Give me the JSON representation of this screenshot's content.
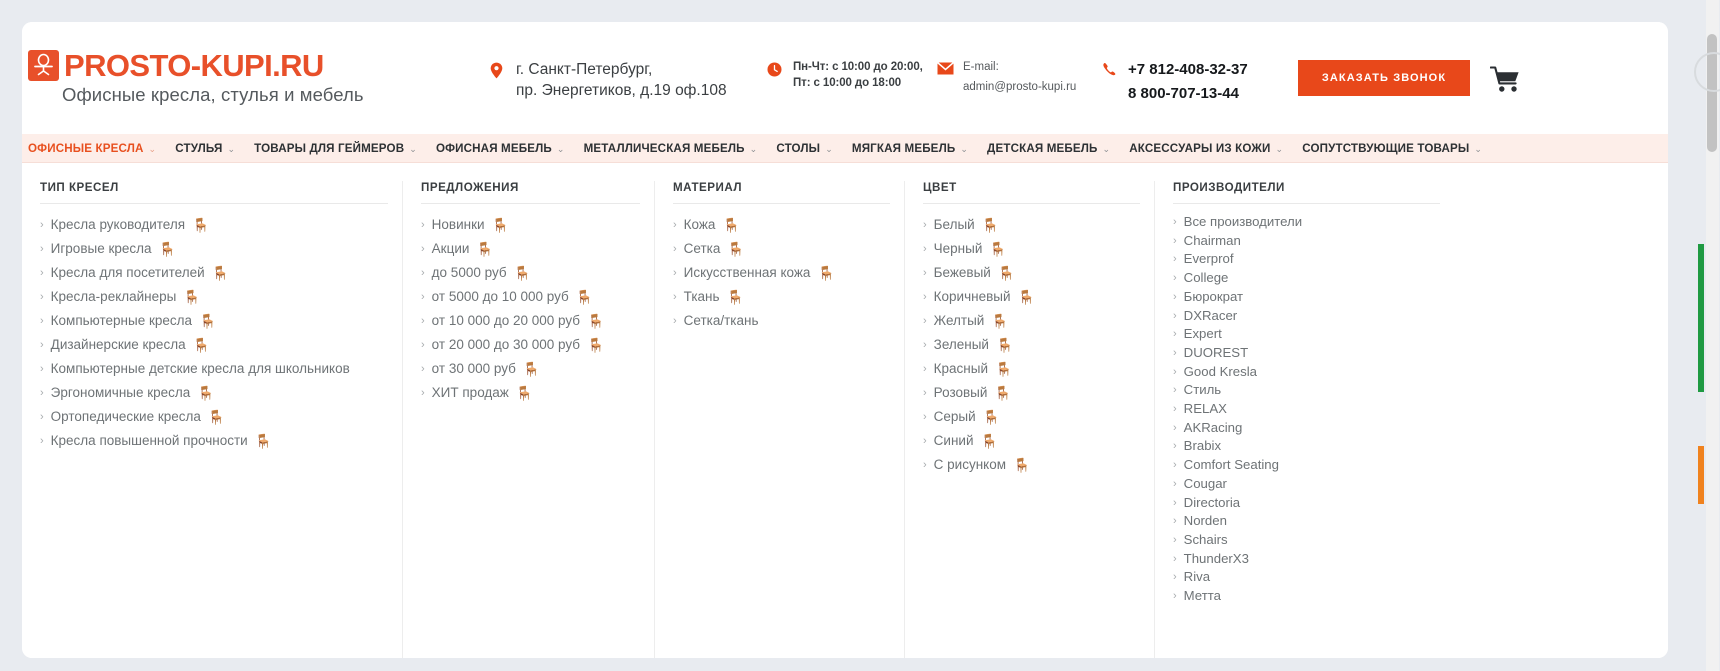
{
  "header": {
    "logo": {
      "mark_icon": "chair-badge-icon",
      "brand": "PROSTO-KUPI.RU",
      "tagline": "Офисные кресла, стулья и мебель"
    },
    "address": {
      "icon": "map-pin-icon",
      "line1": "г. Санкт-Петербург,",
      "line2": "пр. Энергетиков, д.19 оф.108"
    },
    "hours": {
      "icon": "clock-icon",
      "line1": "Пн-Чт: с 10:00 до 20:00,",
      "line2": "Пт: с 10:00 до 18:00"
    },
    "email": {
      "icon": "envelope-icon",
      "label": "E-mail:",
      "value": "admin@prosto-kupi.ru"
    },
    "phone": {
      "icon": "phone-icon",
      "line1": "+7 812-408-32-37",
      "line2": "8 800-707-13-44"
    },
    "cta_label": "ЗАКАЗАТЬ ЗВОНОК",
    "cart_icon": "shopping-cart-icon"
  },
  "colors": {
    "brand_orange": "#e8502a",
    "cta_orange": "#e8481a",
    "nav_bg": "#fdeee9",
    "nav_active": "#e8501f",
    "link_gray": "#6e7376",
    "page_bg": "#e8ebf0"
  },
  "nav": {
    "chevron_icon": "chevron-down-icon",
    "items": [
      {
        "label": "ОФИСНЫЕ КРЕСЛА",
        "active": true
      },
      {
        "label": "СТУЛЬЯ",
        "active": false
      },
      {
        "label": "ТОВАРЫ ДЛЯ ГЕЙМЕРОВ",
        "active": false
      },
      {
        "label": "ОФИСНАЯ МЕБЕЛЬ",
        "active": false
      },
      {
        "label": "МЕТАЛЛИЧЕСКАЯ МЕБЕЛЬ",
        "active": false
      },
      {
        "label": "СТОЛЫ",
        "active": false
      },
      {
        "label": "МЯГКАЯ МЕБЕЛЬ",
        "active": false
      },
      {
        "label": "ДЕТСКАЯ МЕБЕЛЬ",
        "active": false
      },
      {
        "label": "АКСЕССУАРЫ ИЗ КОЖИ",
        "active": false
      },
      {
        "label": "СОПУТСТВУЮЩИЕ ТОВАРЫ",
        "active": false
      }
    ]
  },
  "mega_menu": {
    "link_chevron_icon": "chevron-right-icon",
    "columns": [
      {
        "title": "ТИП КРЕСЕЛ",
        "items": [
          {
            "label": "Кресла руководителя",
            "thumb": "🪑"
          },
          {
            "label": "Игровые кресла",
            "thumb": "🪑"
          },
          {
            "label": "Кресла для посетителей",
            "thumb": "🪑"
          },
          {
            "label": "Кресла-реклайнеры",
            "thumb": "🪑"
          },
          {
            "label": "Компьютерные кресла",
            "thumb": "🪑"
          },
          {
            "label": "Дизайнерские кресла",
            "thumb": "🪑"
          },
          {
            "label": "Компьютерные детские кресла для школьников",
            "thumb": ""
          },
          {
            "label": "Эргономичные кресла",
            "thumb": "🪑"
          },
          {
            "label": "Ортопедические кресла",
            "thumb": "🪑"
          },
          {
            "label": "Кресла повышенной прочности",
            "thumb": "🪑"
          }
        ]
      },
      {
        "title": "ПРЕДЛОЖЕНИЯ",
        "items": [
          {
            "label": "Новинки",
            "thumb": "🪑"
          },
          {
            "label": "Акции",
            "thumb": "🪑"
          },
          {
            "label": "до 5000 руб",
            "thumb": "🪑"
          },
          {
            "label": "от 5000 до 10 000 руб",
            "thumb": "🪑"
          },
          {
            "label": "от 10 000 до 20 000 руб",
            "thumb": "🪑"
          },
          {
            "label": "от 20 000 до 30 000 руб",
            "thumb": "🪑"
          },
          {
            "label": "от 30 000 руб",
            "thumb": "🪑"
          },
          {
            "label": "ХИТ продаж",
            "thumb": "🪑"
          }
        ]
      },
      {
        "title": "МАТЕРИАЛ",
        "items": [
          {
            "label": "Кожа",
            "thumb": "🪑"
          },
          {
            "label": "Сетка",
            "thumb": "🪑"
          },
          {
            "label": "Искусственная кожа",
            "thumb": "🪑"
          },
          {
            "label": "Ткань",
            "thumb": "🪑"
          },
          {
            "label": "Сетка/ткань",
            "thumb": ""
          }
        ]
      },
      {
        "title": "ЦВЕТ",
        "items": [
          {
            "label": "Белый",
            "thumb": "🪑"
          },
          {
            "label": "Черный",
            "thumb": "🪑"
          },
          {
            "label": "Бежевый",
            "thumb": "🪑"
          },
          {
            "label": "Коричневый",
            "thumb": "🪑"
          },
          {
            "label": "Желтый",
            "thumb": "🪑"
          },
          {
            "label": "Зеленый",
            "thumb": "🪑"
          },
          {
            "label": "Красный",
            "thumb": "🪑"
          },
          {
            "label": "Розовый",
            "thumb": "🪑"
          },
          {
            "label": "Серый",
            "thumb": "🪑"
          },
          {
            "label": "Синий",
            "thumb": "🪑"
          },
          {
            "label": "С рисунком",
            "thumb": "🪑"
          }
        ]
      },
      {
        "title": "ПРОИЗВОДИТЕЛИ",
        "items": [
          {
            "label": "Все производители",
            "thumb": ""
          },
          {
            "label": "Chairman",
            "thumb": ""
          },
          {
            "label": "Everprof",
            "thumb": ""
          },
          {
            "label": "College",
            "thumb": ""
          },
          {
            "label": "Бюрократ",
            "thumb": ""
          },
          {
            "label": "DXRacer",
            "thumb": ""
          },
          {
            "label": "Expert",
            "thumb": ""
          },
          {
            "label": "DUOREST",
            "thumb": ""
          },
          {
            "label": "Good Kresla",
            "thumb": ""
          },
          {
            "label": "Стиль",
            "thumb": ""
          },
          {
            "label": "RELAX",
            "thumb": ""
          },
          {
            "label": "AKRacing",
            "thumb": ""
          },
          {
            "label": "Brabix",
            "thumb": ""
          },
          {
            "label": "Comfort Seating",
            "thumb": ""
          },
          {
            "label": "Cougar",
            "thumb": ""
          },
          {
            "label": "Directoria",
            "thumb": ""
          },
          {
            "label": "Norden",
            "thumb": ""
          },
          {
            "label": "Schairs",
            "thumb": ""
          },
          {
            "label": "ThunderX3",
            "thumb": ""
          },
          {
            "label": "Riva",
            "thumb": ""
          },
          {
            "label": "Метта",
            "thumb": ""
          }
        ]
      }
    ]
  }
}
